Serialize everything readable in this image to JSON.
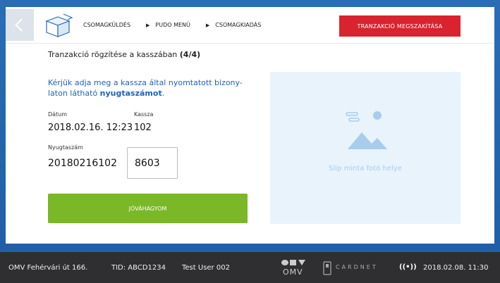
{
  "header": {
    "back_label": "",
    "breadcrumb": [
      "CSOMAGKÜLDÉS",
      "PUDO MENÜ",
      "CSOMAGKIADÁS"
    ],
    "cancel_label": "TRANZAKCIÓ MEGSZAKÍTÁSA"
  },
  "main": {
    "step_title_prefix": "Tranzakció rögzítése a kasszában ",
    "step_title_count": "(4/4)",
    "instruction_line1": "Kérjük adja meg a kassza által nyomtatott bizony-",
    "instruction_line2_prefix": "laton látható ",
    "instruction_line2_bold": "nyugtaszámot",
    "instruction_line2_suffix": ".",
    "date_label": "Dátum",
    "date_value": "2018.02.16. 12:23",
    "register_label": "Kassza",
    "register_value": "102",
    "receipt_label": "Nyugtaszám",
    "receipt_prefix": "20180216102",
    "receipt_input_value": "8603",
    "confirm_label": "JÓVÁHAGYOM"
  },
  "slip": {
    "placeholder_text": "Slip minta fotó helye"
  },
  "footer": {
    "location": "OMV Fehérvári út 166.",
    "tid": "TID: ABCD1234",
    "user": "Test User 002",
    "omv_logo_text": "OMV",
    "cardnet_text": "CARDNET",
    "datetime": "2018.02.08. 11:30"
  },
  "colors": {
    "accent_blue": "#1d63b8",
    "cancel_red": "#d9232e",
    "confirm_green": "#7ab827",
    "footer_bg": "#2f2f32"
  }
}
